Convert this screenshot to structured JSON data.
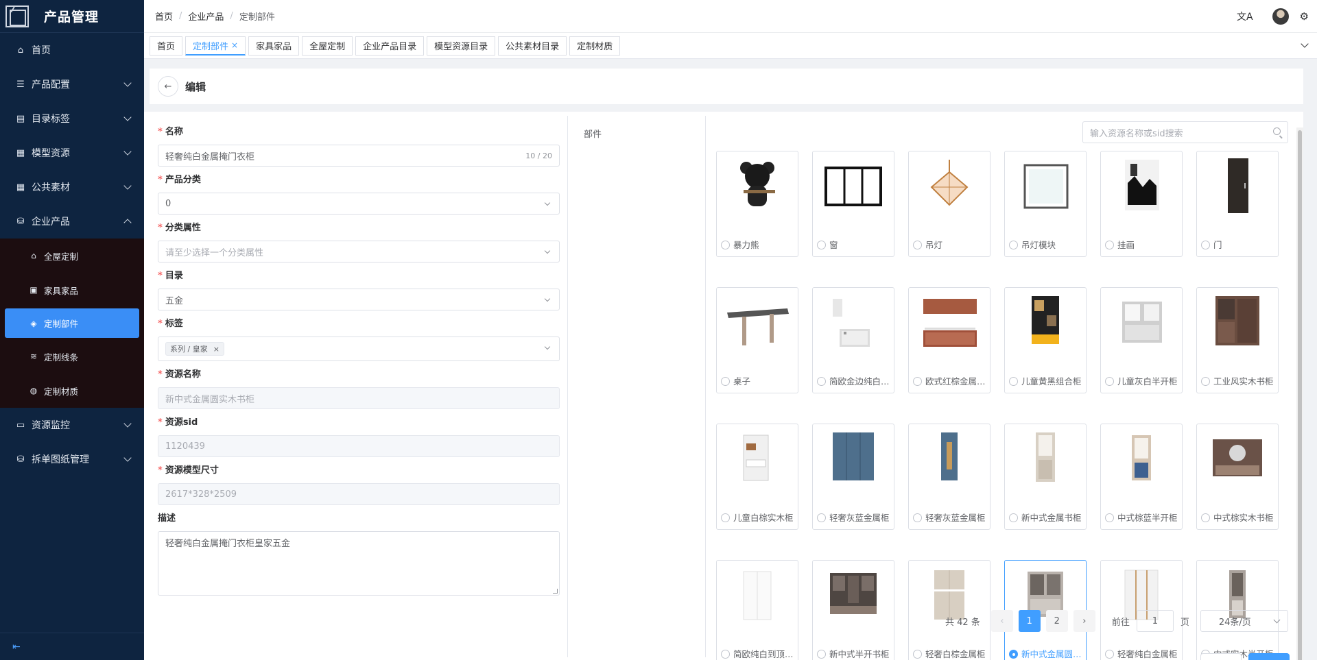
{
  "app": {
    "title": "产品管理"
  },
  "sidebar": {
    "items": [
      {
        "label": "首页",
        "icon": "home-icon",
        "glyph": "⌂"
      },
      {
        "label": "产品配置",
        "icon": "list-icon",
        "glyph": "☰"
      },
      {
        "label": "目录标签",
        "icon": "document-icon",
        "glyph": "▤"
      },
      {
        "label": "模型资源",
        "icon": "grid-icon",
        "glyph": "▦"
      },
      {
        "label": "公共素材",
        "icon": "table-icon",
        "glyph": "▦"
      },
      {
        "label": "企业产品",
        "icon": "database-icon",
        "glyph": "⛁"
      }
    ],
    "sub_items": [
      {
        "label": "全屋定制",
        "icon": "house-icon",
        "glyph": "⌂"
      },
      {
        "label": "家具家品",
        "icon": "furniture-icon",
        "glyph": "▣"
      },
      {
        "label": "定制部件",
        "icon": "layers-icon",
        "glyph": "◈"
      },
      {
        "label": "定制线条",
        "icon": "wind-icon",
        "glyph": "≋"
      },
      {
        "label": "定制材质",
        "icon": "palette-icon",
        "glyph": "◍"
      }
    ],
    "bottom_items": [
      {
        "label": "资源监控",
        "icon": "monitor-icon",
        "glyph": "▭"
      },
      {
        "label": "拆单图纸管理",
        "icon": "database-icon",
        "glyph": "⛁"
      }
    ]
  },
  "header": {
    "breadcrumb": [
      "首页",
      "企业产品",
      "定制部件"
    ],
    "separator": "/"
  },
  "tabs": [
    {
      "label": "首页"
    },
    {
      "label": "定制部件",
      "close": "×"
    },
    {
      "label": "家具家品"
    },
    {
      "label": "全屋定制"
    },
    {
      "label": "企业产品目录"
    },
    {
      "label": "模型资源目录"
    },
    {
      "label": "公共素材目录"
    },
    {
      "label": "定制材质"
    }
  ],
  "page": {
    "title": "编辑",
    "back": "←"
  },
  "form": {
    "name_label": "名称",
    "name_value": "轻奢纯白金属掩门衣柜",
    "name_counter": "10 / 20",
    "category_label": "产品分类",
    "category_value": "0",
    "attr_label": "分类属性",
    "attr_placeholder": "请至少选择一个分类属性",
    "catalog_label": "目录",
    "catalog_value": "五金",
    "tags_label": "标签",
    "tag_value": "系列 / 皇家",
    "tag_close": "×",
    "resource_name_label": "资源名称",
    "resource_name_value": "新中式金属圆实木书柜",
    "resource_sid_label": "资源sid",
    "resource_sid_value": "1120439",
    "resource_size_label": "资源模型尺寸",
    "resource_size_value": "2617*328*2509",
    "desc_label": "描述",
    "desc_value": "轻奢纯白金属掩门衣柜皇家五金",
    "required_mark": "*"
  },
  "parts": {
    "label": "部件",
    "search_placeholder": "输入资源名称或sid搜索",
    "items": [
      {
        "name": "暴力熊",
        "thumb": "bear"
      },
      {
        "name": "窗",
        "thumb": "window"
      },
      {
        "name": "吊灯",
        "thumb": "lamp"
      },
      {
        "name": "吊灯模块",
        "thumb": "lampmodule"
      },
      {
        "name": "挂画",
        "thumb": "painting"
      },
      {
        "name": "门",
        "thumb": "door"
      },
      {
        "name": "桌子",
        "thumb": "table"
      },
      {
        "name": "简欧金边纯白橱柜",
        "thumb": "kitchen-white"
      },
      {
        "name": "欧式红棕金属橱柜",
        "thumb": "kitchen-red"
      },
      {
        "name": "儿童黄黑组合柜",
        "thumb": "yellow-black"
      },
      {
        "name": "儿童灰白半开柜",
        "thumb": "gray-white"
      },
      {
        "name": "工业风实木书柜",
        "thumb": "industrial"
      },
      {
        "name": "儿童白棕实木柜",
        "thumb": "white-brown"
      },
      {
        "name": "轻奢灰蓝金属柜",
        "thumb": "blue-wide"
      },
      {
        "name": "轻奢灰蓝金属柜",
        "thumb": "blue-narrow"
      },
      {
        "name": "新中式金属书柜",
        "thumb": "beige-tall"
      },
      {
        "name": "中式棕蓝半开柜",
        "thumb": "brown-blue"
      },
      {
        "name": "中式棕实木书柜",
        "thumb": "brown-wide"
      },
      {
        "name": "简欧纯白到顶衣柜",
        "thumb": "white-ward"
      },
      {
        "name": "新中式半开书柜",
        "thumb": "dark-shelf"
      },
      {
        "name": "轻奢白棕金属柜",
        "thumb": "beige-ward"
      },
      {
        "name": "新中式金属圆实木书柜",
        "thumb": "gray-book",
        "selected": true
      },
      {
        "name": "轻奢纯白金属柜",
        "thumb": "white-gold"
      },
      {
        "name": "中式实木半开柜",
        "thumb": "gray-narrow"
      }
    ]
  },
  "pagination": {
    "total": "共 42 条",
    "prev": "‹",
    "pages": [
      "1",
      "2"
    ],
    "next": "›",
    "goto_label": "前往",
    "goto_value": "1",
    "page_unit": "页",
    "page_size": "24条/页"
  },
  "colors": {
    "sidebar_bg": "#0e2440",
    "submenu_bg": "#1c0d10",
    "accent": "#409eff"
  }
}
